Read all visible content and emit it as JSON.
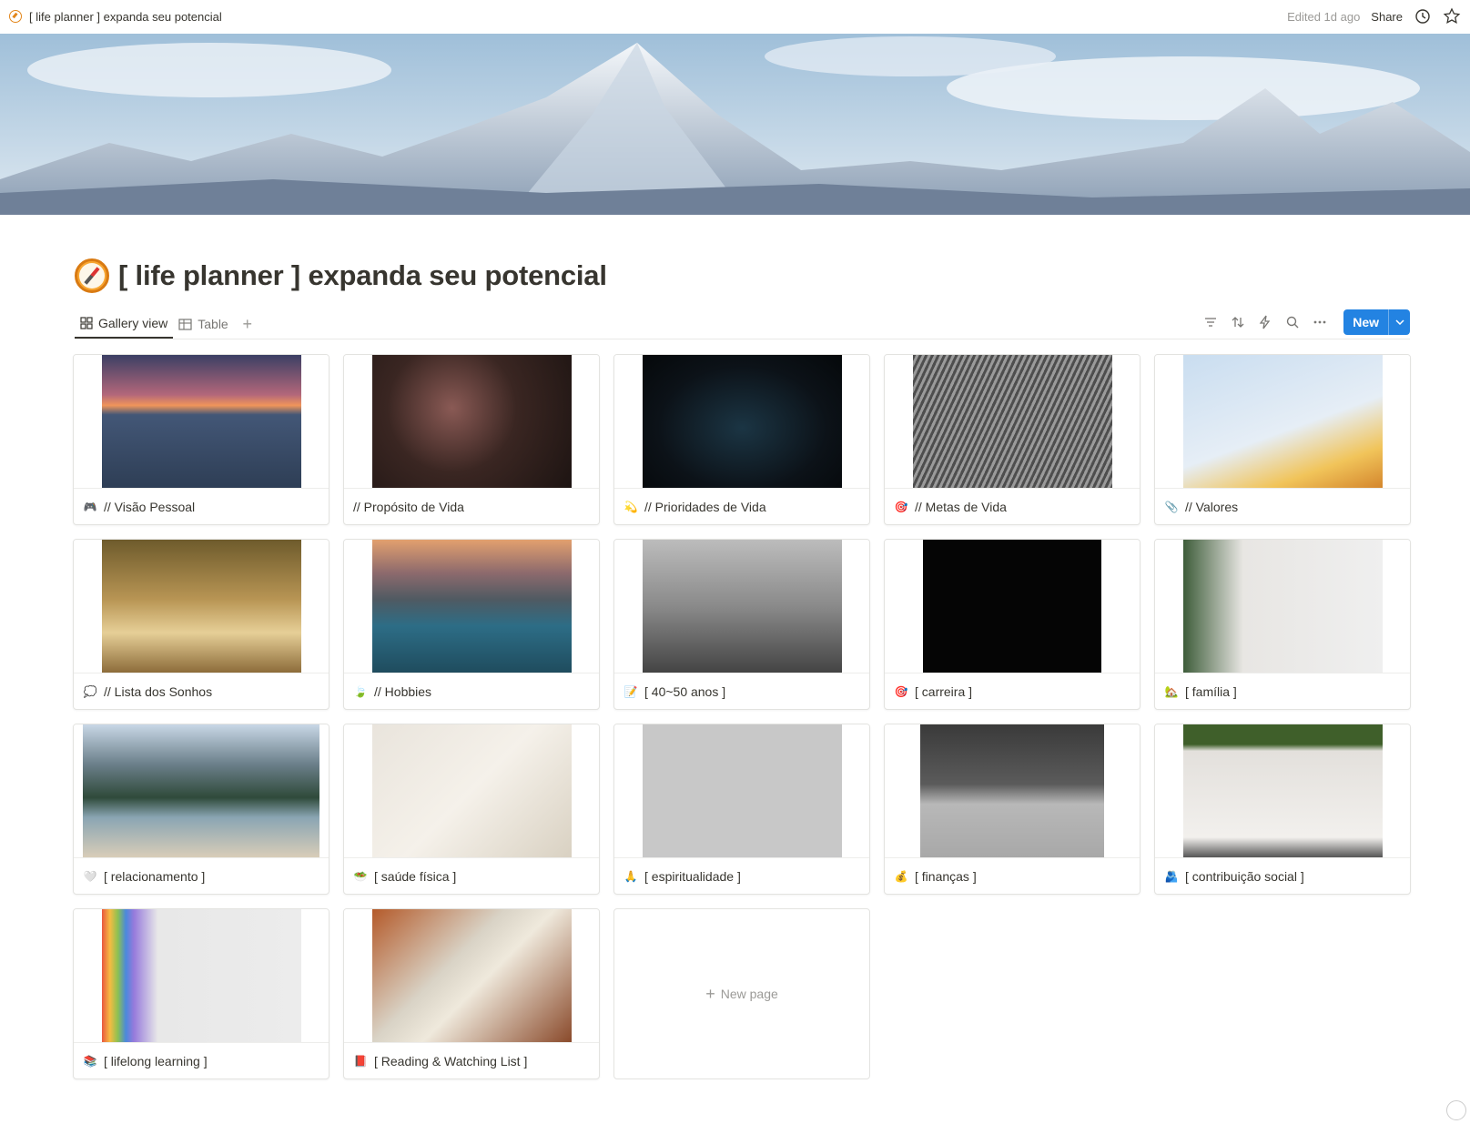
{
  "topbar": {
    "breadcrumb": "[ life planner ] expanda seu potencial",
    "edited": "Edited 1d ago",
    "share": "Share"
  },
  "page": {
    "title": "[ life planner ] expanda seu potencial"
  },
  "views": {
    "tabs": [
      {
        "label": "Gallery view",
        "active": true
      },
      {
        "label": "Table",
        "active": false
      }
    ],
    "new_button": "New"
  },
  "cards": [
    {
      "title": "// Visão Pessoal",
      "icon": "game-controller-icon",
      "glyph": "🎮",
      "image": "sunset-pier"
    },
    {
      "title": "// Propósito de Vida",
      "icon": "",
      "glyph": "",
      "image": "neon-sign-this-is-the-sign"
    },
    {
      "title": "// Prioridades de Vida",
      "icon": "dizzy-star-icon",
      "glyph": "💫",
      "image": "neon-do-something-great"
    },
    {
      "title": "// Metas de Vida",
      "icon": "target-icon",
      "glyph": "🎯",
      "image": "goals-tag-pen"
    },
    {
      "title": "// Valores",
      "icon": "paperclip-icon",
      "glyph": "📎",
      "image": "yellow-flowers-sky"
    },
    {
      "title": "// Lista dos Sonhos",
      "icon": "speech-balloon-icon",
      "glyph": "💭",
      "image": "dream-sculpture"
    },
    {
      "title": "// Hobbies",
      "icon": "leaves-icon",
      "glyph": "🍃",
      "image": "mountain-lake"
    },
    {
      "title": "[ 40~50 anos ]",
      "icon": "memo-icon",
      "glyph": "📝",
      "image": "passion-led-us-here"
    },
    {
      "title": "[ carreira ]",
      "icon": "target-icon",
      "glyph": "🎯",
      "image": "go-up-never-stop-neon"
    },
    {
      "title": "[ família ]",
      "icon": "house-garden-icon",
      "glyph": "🏡",
      "image": "home-sweet-home-board"
    },
    {
      "title": "[ relacionamento ]",
      "icon": "white-heart-icon",
      "glyph": "🤍",
      "image": "couple-on-rock"
    },
    {
      "title": "[ saúde física ]",
      "icon": "salad-icon",
      "glyph": "🥗",
      "image": "herbs-and-spices"
    },
    {
      "title": "[ espiritualidade ]",
      "icon": "praying-hands-icon",
      "glyph": "🙏",
      "image": "zen-tiles"
    },
    {
      "title": "[ finanças ]",
      "icon": "money-bag-icon",
      "glyph": "💰",
      "image": "laptop-money"
    },
    {
      "title": "[ contribuição social ]",
      "icon": "people-icon",
      "glyph": "🫂",
      "image": "we-like-you-too-wall"
    },
    {
      "title": "[ lifelong learning ]",
      "icon": "books-icon",
      "glyph": "📚",
      "image": "colored-pencils"
    },
    {
      "title": "[ Reading & Watching List ]",
      "icon": "red-book-icon",
      "glyph": "📕",
      "image": "person-reading-book"
    }
  ],
  "new_page": "New page",
  "colors": {
    "accent": "#2383e2",
    "text": "#37352f",
    "muted": "#9b9a97"
  }
}
